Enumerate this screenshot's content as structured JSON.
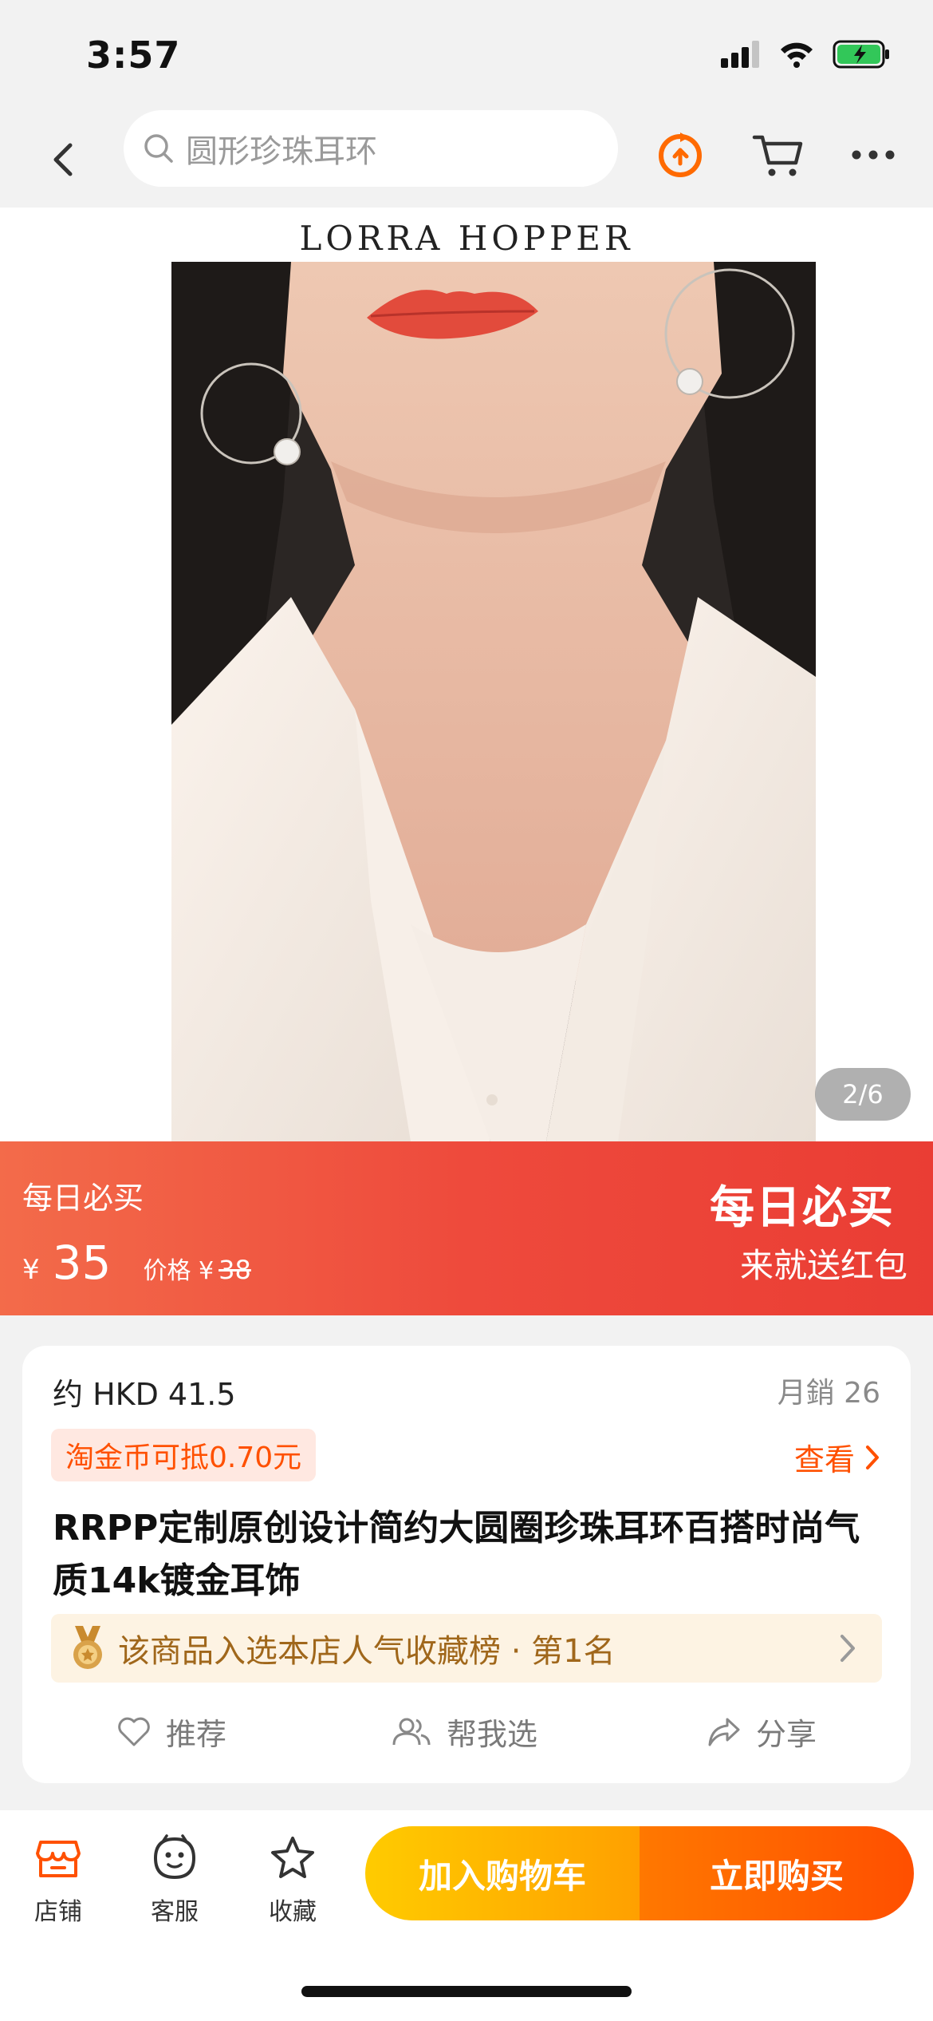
{
  "status_bar": {
    "time": "3:57"
  },
  "search": {
    "placeholder": "圆形珍珠耳环"
  },
  "hero": {
    "brand": "LORRA HOPPER",
    "page_indicator": "2/6"
  },
  "promo": {
    "tag": "每日必买",
    "currency": "¥",
    "price": "35",
    "old_price_label": "价格 ¥",
    "old_price": "38",
    "title": "每日必买",
    "subtitle": "来就送红包"
  },
  "product": {
    "approx_price": "约 HKD 41.5",
    "monthly_sales": "月銷 26",
    "coin_discount": "淘金币可抵0.70元",
    "view_label": "查看",
    "title": "RRPP定制原创设计简约大圆圈珍珠耳环百搭时尚气质14k镀金耳饰",
    "rank_text": "该商品入选本店人气收藏榜 · 第1名",
    "actions": {
      "recommend": "推荐",
      "help_choose": "帮我选",
      "share": "分享"
    }
  },
  "bottom_bar": {
    "tabs": {
      "store": "店铺",
      "service": "客服",
      "favorite": "收藏"
    },
    "add_to_cart": "加入购物车",
    "buy_now": "立即购买"
  },
  "colors": {
    "accent": "#ff5000",
    "promo_start": "#f36b4a",
    "promo_end": "#ea3d34",
    "cart_button": "#ffa000",
    "rank_text": "#a0671b"
  },
  "icons": [
    "signal-icon",
    "wifi-icon",
    "battery-icon",
    "back-icon",
    "search-icon",
    "refresh-icon",
    "cart-icon",
    "more-icon",
    "heart-icon",
    "people-icon",
    "share-icon",
    "medal-icon",
    "store-icon",
    "service-icon",
    "star-icon"
  ]
}
